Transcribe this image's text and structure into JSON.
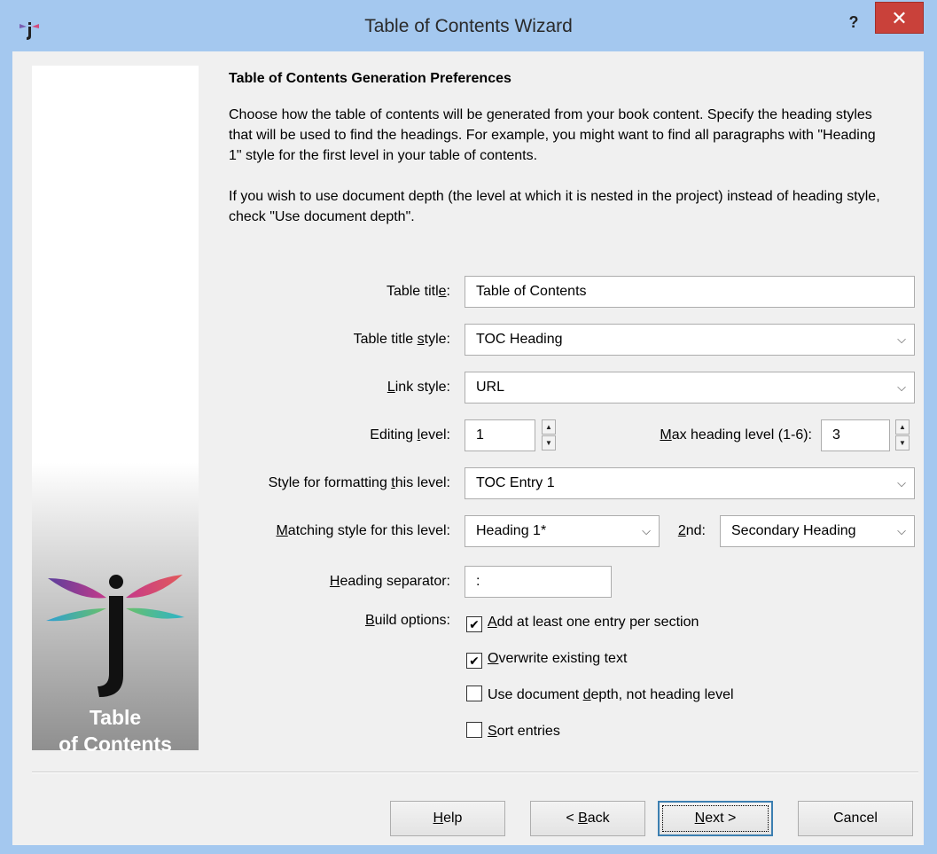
{
  "window": {
    "title": "Table of Contents Wizard",
    "help_glyph": "?",
    "close_glyph": "✕"
  },
  "sidebar": {
    "text_line1": "Table",
    "text_line2": "of Contents"
  },
  "page": {
    "heading": "Table of Contents Generation Preferences",
    "paragraph1": "Choose how the table of contents will be generated from your book content. Specify the heading styles that will be used to find the headings. For example, you might want to find all paragraphs with \"Heading 1\" style for the first level in your table of contents.",
    "paragraph2": "If you wish to use document depth (the level at which it is nested in the project) instead of heading style, check \"Use document depth\"."
  },
  "form": {
    "table_title": {
      "label_pre": "Table titl",
      "label_u": "e",
      "label_post": ":",
      "value": "Table of Contents"
    },
    "table_title_style": {
      "label_pre": "Table title ",
      "label_u": "s",
      "label_post": "tyle:",
      "value": "TOC Heading"
    },
    "link_style": {
      "label_pre": "",
      "label_u": "L",
      "label_post": "ink style:",
      "value": "URL"
    },
    "editing_level": {
      "label_pre": "Editing ",
      "label_u": "l",
      "label_post": "evel:",
      "value": "1"
    },
    "max_heading_level": {
      "label_pre": "",
      "label_u": "M",
      "label_post": "ax heading level (1-6):",
      "value": "3"
    },
    "style_for_level": {
      "label_pre": "Style for formatting ",
      "label_u": "t",
      "label_post": "his level:",
      "value": "TOC Entry 1"
    },
    "matching_style": {
      "label_pre": "",
      "label_u": "M",
      "label_post": "atching style for this level:",
      "value": "Heading 1*"
    },
    "second": {
      "label_pre": "",
      "label_u": "2",
      "label_post": "nd:",
      "value": "Secondary Heading"
    },
    "heading_separator": {
      "label_pre": "",
      "label_u": "H",
      "label_post": "eading separator:",
      "value": ":"
    },
    "build_options_label_pre": "",
    "build_options_label_u": "B",
    "build_options_label_post": "uild options:",
    "options": [
      {
        "label_pre": "",
        "label_u": "A",
        "label_post": "dd at least one entry per section",
        "checked": true
      },
      {
        "label_pre": "",
        "label_u": "O",
        "label_post": "verwrite existing text",
        "checked": true
      },
      {
        "label_pre": "Use document ",
        "label_u": "d",
        "label_post": "epth, not heading level",
        "checked": false
      },
      {
        "label_pre": "",
        "label_u": "S",
        "label_post": "ort entries",
        "checked": false
      }
    ]
  },
  "buttons": {
    "help": {
      "u": "H",
      "rest": "elp"
    },
    "back": {
      "pre": "< ",
      "u": "B",
      "rest": "ack"
    },
    "next": {
      "u": "N",
      "rest": "ext >"
    },
    "cancel": "Cancel"
  },
  "glyphs": {
    "check": "✔",
    "dropdown": "⌵",
    "spin_up": "▲",
    "spin_down": "▼"
  },
  "colors": {
    "title_bar": "#a4c8ef",
    "close_button": "#c9413a",
    "dialog_bg": "#f0f0f0",
    "default_button_border": "#3c7fb1"
  }
}
